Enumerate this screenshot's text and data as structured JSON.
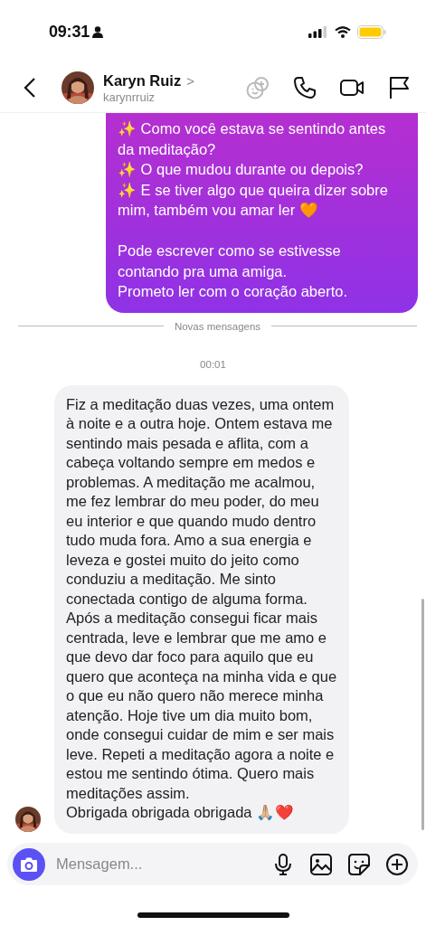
{
  "status_bar": {
    "time": "09:31"
  },
  "header": {
    "name": "Karyn Ruiz",
    "chevron": ">",
    "username": "karynrruiz"
  },
  "sent_message": {
    "text": "✨ Como você estava se sentindo antes da meditação?\n✨ O que mudou durante ou depois?\n✨ E se tiver algo que queira dizer sobre mim, também vou amar ler 🧡\n\nPode escrever como se estivesse contando pra uma amiga.\nPrometo ler com o coração aberto."
  },
  "divider": {
    "label": "Novas mensagens"
  },
  "timestamp": "00:01",
  "received_message": {
    "text": "Fiz a meditação duas vezes, uma ontem à noite e a outra hoje. Ontem estava me sentindo mais pesada e aflita, com a cabeça voltando sempre em medos e problemas. A meditação me acalmou, me fez lembrar do meu poder, do meu eu interior e que quando mudo dentro tudo muda fora. Amo a sua energia e leveza e gostei muito do jeito como conduziu a meditação. Me sinto conectada contigo de alguma forma. Após a meditação consegui ficar mais centrada, leve e lembrar que me amo e que devo dar foco para aquilo que eu quero que aconteça na minha vida e que o que eu não quero não merece minha atenção. Hoje tive um dia muito bom, onde consegui cuidar de mim e ser mais leve. Repeti a meditação agora a noite e estou me sentindo ótima. Quero mais meditações assim.\nObrigada obrigada obrigada 🙏🏼❤️"
  },
  "composer": {
    "placeholder": "Mensagem..."
  }
}
